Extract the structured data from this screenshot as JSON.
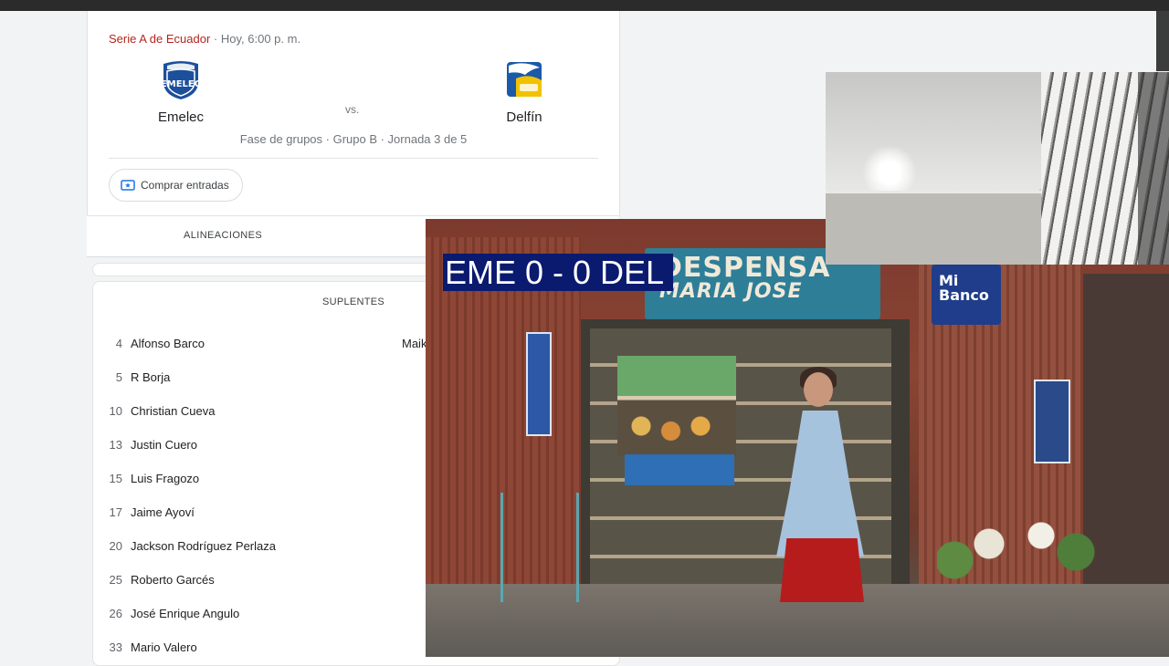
{
  "match": {
    "league": "Serie A de Ecuador",
    "time": " · Hoy, 6:00 p. m.",
    "home_team": "Emelec",
    "away_team": "Delfín",
    "vs": "vs.",
    "stage": "Fase de grupos · Grupo B · Jornada 3 de 5",
    "tickets_label": "Comprar entradas"
  },
  "tabs": {
    "lineups": "ALINEACIONES"
  },
  "substitutes": {
    "title": "SUPLENTES",
    "away_first": "Maik",
    "players": [
      {
        "number": "4",
        "name": "Alfonso Barco"
      },
      {
        "number": "5",
        "name": "R Borja"
      },
      {
        "number": "10",
        "name": "Christian Cueva"
      },
      {
        "number": "13",
        "name": "Justin Cuero"
      },
      {
        "number": "15",
        "name": "Luis Fragozo"
      },
      {
        "number": "17",
        "name": "Jaime Ayoví"
      },
      {
        "number": "20",
        "name": "Jackson Rodríguez Perlaza"
      },
      {
        "number": "25",
        "name": "Roberto Garcés"
      },
      {
        "number": "26",
        "name": "José Enrique Angulo"
      },
      {
        "number": "33",
        "name": "Mario Valero"
      }
    ]
  },
  "video": {
    "score_overlay": "EME 0 - 0 DEL",
    "sign_line1": "DESPENSA",
    "sign_line2": "MARIA JOSE",
    "bank_sign": "Mi Banco"
  },
  "colors": {
    "league": "#b3261e",
    "score_bg": "#0a1a6e",
    "emelec_blue": "#1c4f9c",
    "delfin_yellow": "#f2c200"
  }
}
